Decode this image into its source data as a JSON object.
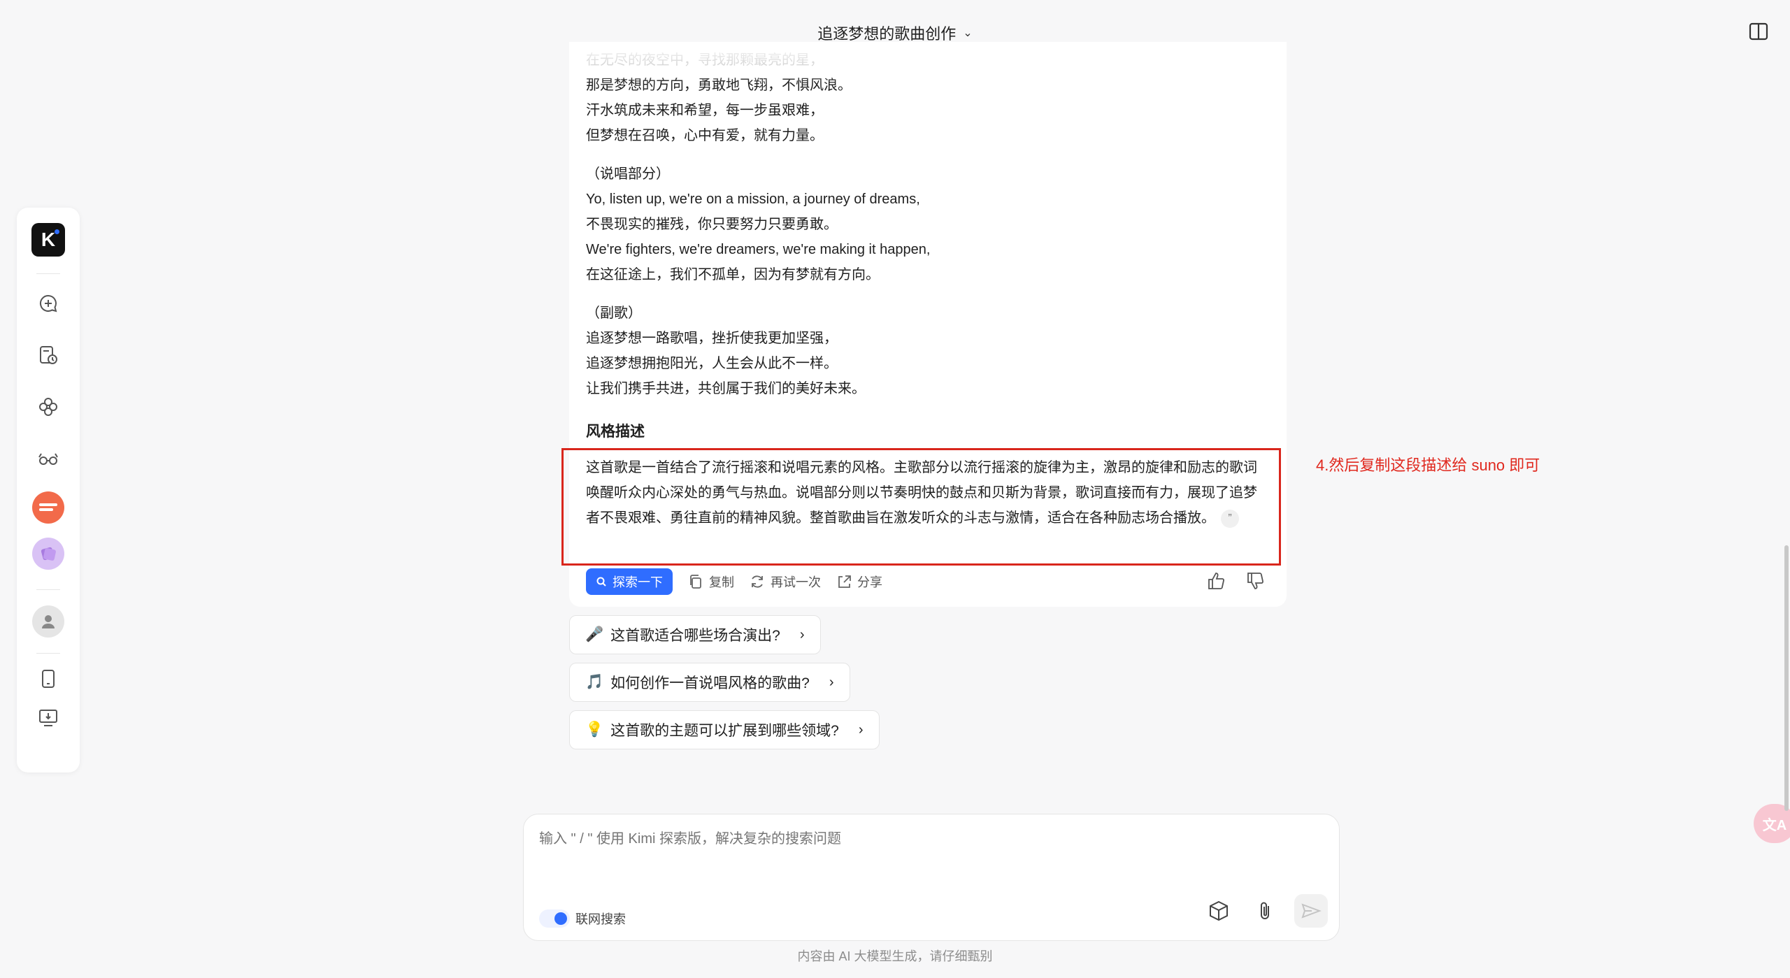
{
  "header": {
    "title": "追逐梦想的歌曲创作"
  },
  "lyrics": {
    "faded_line": "在无尽的夜空中，寻找那颗最亮的星，",
    "verse_tail": [
      "那是梦想的方向，勇敢地飞翔，不惧风浪。",
      "汗水筑成未来和希望，每一步虽艰难，",
      "但梦想在召唤，心中有爱，就有力量。"
    ],
    "rap_label": "（说唱部分）",
    "rap": [
      "Yo, listen up, we're on a mission, a journey of dreams,",
      "不畏现实的摧残，你只要努力只要勇敢。",
      "We're fighters, we're dreamers, we're making it happen,",
      "在这征途上，我们不孤单，因为有梦就有方向。"
    ],
    "chorus_label": "（副歌）",
    "chorus": [
      "追逐梦想一路歌唱，挫折使我更加坚强，",
      "追逐梦想拥抱阳光，人生会从此不一样。",
      "让我们携手共进，共创属于我们的美好未来。"
    ]
  },
  "style": {
    "title": "风格描述",
    "description": "这首歌是一首结合了流行摇滚和说唱元素的风格。主歌部分以流行摇滚的旋律为主，激昂的旋律和励志的歌词唤醒听众内心深处的勇气与热血。说唱部分则以节奏明快的鼓点和贝斯为背景，歌词直接而有力，展现了追梦者不畏艰难、勇往直前的精神风貌。整首歌曲旨在激发听众的斗志与激情，适合在各种励志场合播放。",
    "quote_glyph": "”"
  },
  "annotation": "4.然后复制这段描述给 suno 即可",
  "actions": {
    "explore": "探索一下",
    "copy": "复制",
    "retry": "再试一次",
    "share": "分享"
  },
  "suggestions": [
    {
      "emoji": "🎤",
      "text": "这首歌适合哪些场合演出?"
    },
    {
      "emoji": "🎵",
      "text": "如何创作一首说唱风格的歌曲?"
    },
    {
      "emoji": "💡",
      "text": "这首歌的主题可以扩展到哪些领域?"
    }
  ],
  "input": {
    "placeholder": "输入 \" / \" 使用 Kimi 探索版，解决复杂的搜索问题",
    "web_search": "联网搜索"
  },
  "footer": "内容由 AI 大模型生成，请仔细甄别",
  "logo": {
    "letter": "K"
  },
  "colors": {
    "accent": "#2f6dff",
    "annotation_red": "#e0281e",
    "box_red": "#d9261c"
  }
}
